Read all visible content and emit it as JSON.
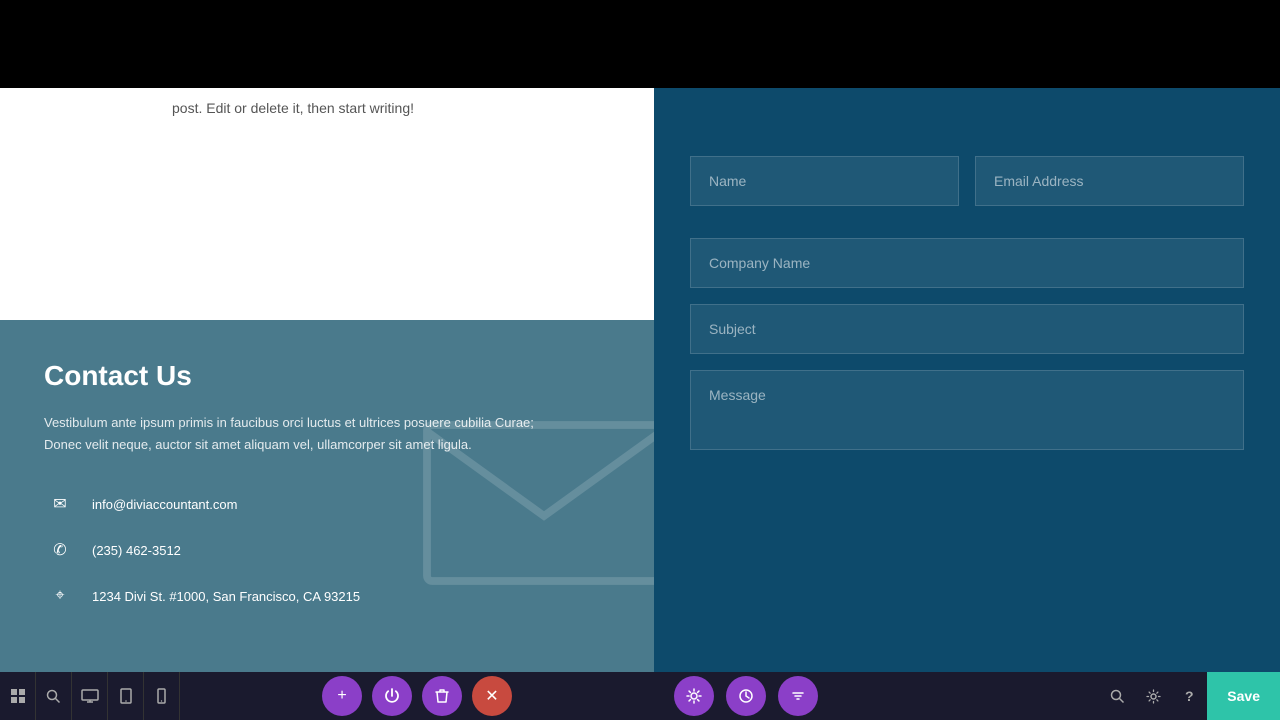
{
  "topBar": {
    "visible": true
  },
  "postText": "post. Edit or delete it, then start writing!",
  "contactSection": {
    "heading": "Contact Us",
    "description": "Vestibulum ante ipsum primis in faucibus orci luctus et ultrices posuere cubilia Curae; Donec velit neque, auctor sit amet aliquam vel, ullamcorper sit amet ligula.",
    "email": "info@diviaccountant.com",
    "phone": "(235) 462-3512",
    "address": "1234 Divi St. #1000, San Francisco, CA 93215"
  },
  "form": {
    "namePlaceholder": "Name",
    "emailPlaceholder": "Email Address",
    "companyPlaceholder": "Company Name",
    "subjectPlaceholder": "Subject",
    "messagePlaceholder": "Message"
  },
  "toolbar": {
    "saveBtnLabel": "Save",
    "fabAdd": "+",
    "fabPower": "⏻",
    "fabTrash": "🗑",
    "fabClose": "✕"
  }
}
